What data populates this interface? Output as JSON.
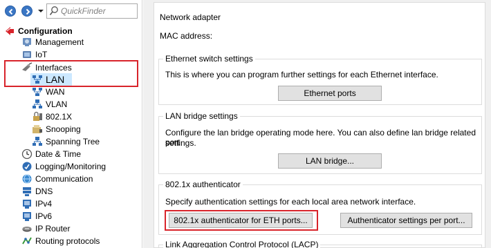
{
  "colors": {
    "highlight_red": "#d8232a",
    "selection_blue": "#cce8ff",
    "nav_blue": "#3a76c4"
  },
  "toolbar": {
    "back_icon": "back-arrow-icon",
    "forward_icon": "forward-arrow-icon",
    "dropdown_icon": "chevron-down-icon",
    "search_icon": "magnifier-icon",
    "quickfinder_placeholder": "QuickFinder"
  },
  "tree": {
    "items": [
      {
        "label": "Configuration",
        "icon": "configuration-icon",
        "bold": true
      },
      {
        "label": "Management",
        "icon": "management-icon"
      },
      {
        "label": "IoT",
        "icon": "iot-icon"
      },
      {
        "label": "Interfaces",
        "icon": "interfaces-icon"
      },
      {
        "label": "LAN",
        "icon": "lan-icon",
        "selected": true
      },
      {
        "label": "WAN",
        "icon": "wan-icon"
      },
      {
        "label": "VLAN",
        "icon": "vlan-icon"
      },
      {
        "label": "802.1X",
        "icon": "dot1x-icon"
      },
      {
        "label": "Snooping",
        "icon": "snooping-icon"
      },
      {
        "label": "Spanning Tree",
        "icon": "spanning-tree-icon"
      },
      {
        "label": "Date & Time",
        "icon": "clock-icon"
      },
      {
        "label": "Logging/Monitoring",
        "icon": "monitoring-icon"
      },
      {
        "label": "Communication",
        "icon": "communication-icon"
      },
      {
        "label": "DNS",
        "icon": "dns-icon"
      },
      {
        "label": "IPv4",
        "icon": "ipv4-icon"
      },
      {
        "label": "IPv6",
        "icon": "ipv6-icon"
      },
      {
        "label": "IP Router",
        "icon": "router-icon"
      },
      {
        "label": "Routing protocols",
        "icon": "routing-protocols-icon"
      }
    ]
  },
  "main": {
    "network_adapter": {
      "title": "Network adapter",
      "mac_label": "MAC address:"
    },
    "ethernet_switch": {
      "title": "Ethernet switch settings",
      "description": "This is where you can program further settings for each Ethernet interface.",
      "button": "Ethernet ports"
    },
    "lan_bridge": {
      "title": "LAN bridge settings",
      "description_line1": "Configure the lan bridge operating mode here. You can also define lan bridge related port",
      "description_line2": "settings.",
      "button": "LAN bridge..."
    },
    "authenticator": {
      "title": "802.1x authenticator",
      "description": "Specify authentication settings for each local area network interface.",
      "button_eth": "802.1x authenticator for ETH ports...",
      "button_settings": "Authenticator settings per port..."
    },
    "lacp": {
      "title": "Link Aggregation Control Protocol (LACP)"
    }
  }
}
